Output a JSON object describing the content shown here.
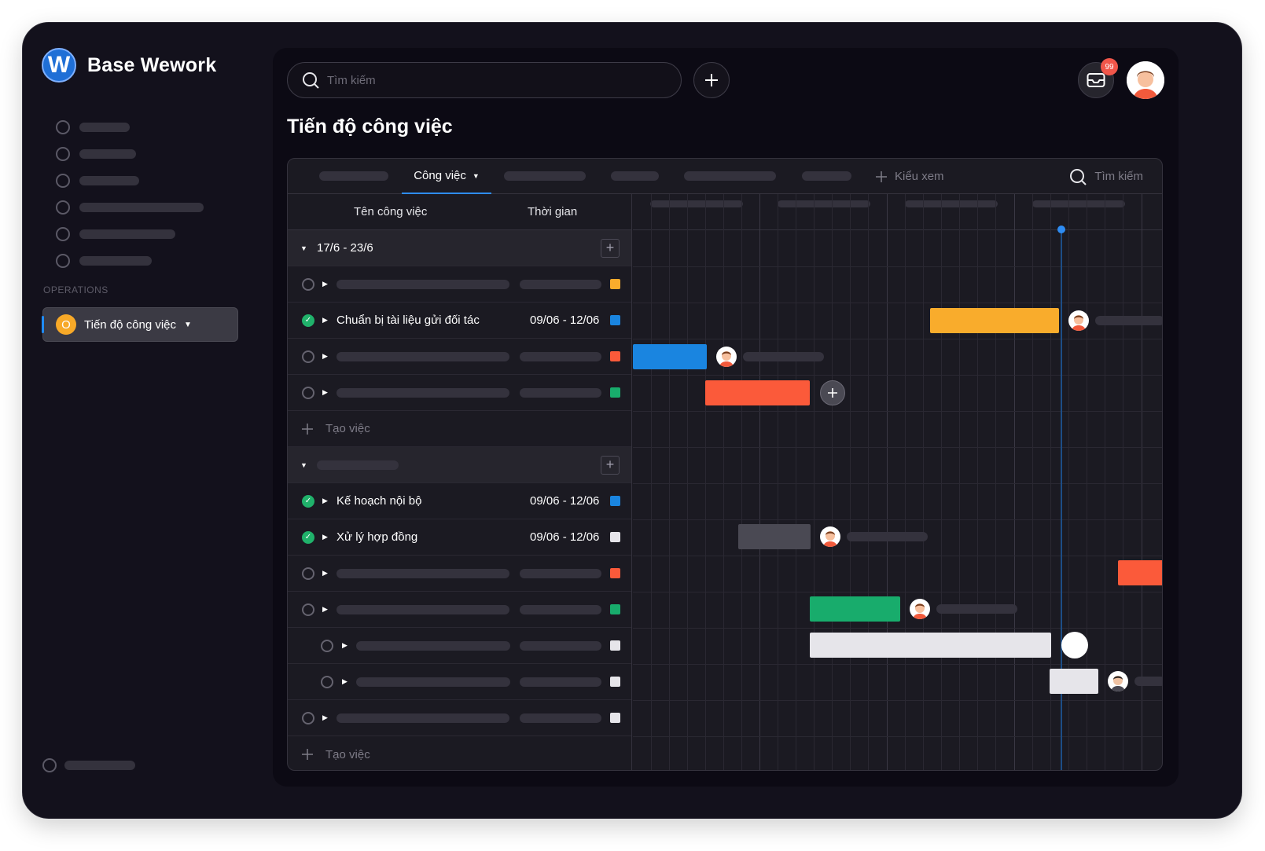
{
  "app": {
    "name": "Base Wework",
    "logo_letter": "W"
  },
  "sidebar": {
    "section_label": "OPERATIONS",
    "active_item": {
      "label": "Tiến độ công việc",
      "initial": "O"
    }
  },
  "header": {
    "search_placeholder": "Tìm kiếm",
    "notification_count": "99"
  },
  "page": {
    "title": "Tiến độ công việc"
  },
  "board": {
    "tabs": {
      "active_label": "Công việc",
      "add_view_label": "Kiểu xem",
      "search_label": "Tìm kiếm"
    },
    "columns": {
      "name": "Tên công việc",
      "time": "Thời gian"
    },
    "group1": {
      "label": "17/6 - 23/6"
    },
    "tasks": {
      "t1": {
        "name": "Chuẩn bị tài liệu gửi đối tác",
        "dates": "09/06 - 12/06"
      },
      "t2": {
        "name": "Kế hoạch nội bộ",
        "dates": "09/06 - 12/06"
      },
      "t3": {
        "name": "Xử lý hợp đồng",
        "dates": "09/06 - 12/06"
      }
    },
    "create_label": "Tạo việc"
  },
  "colors": {
    "yellow": "#f9ac2c",
    "blue": "#1a85e0",
    "red": "#fb5a3a",
    "green": "#18ac6c",
    "white": "#e6e5ea",
    "gray": "#4a4953",
    "accent": "#2e8cf3"
  }
}
